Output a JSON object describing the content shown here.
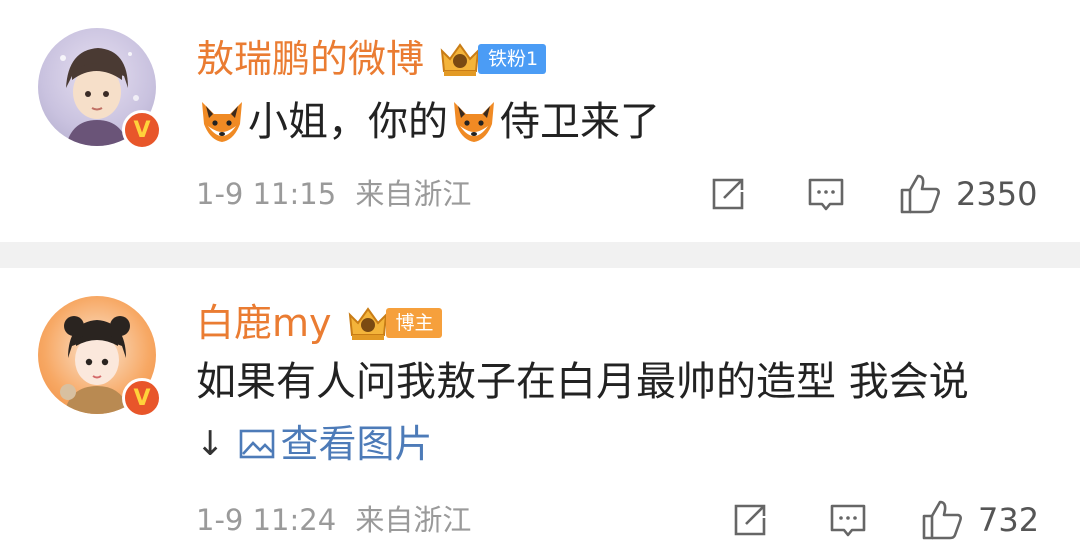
{
  "comments": [
    {
      "username": "敖瑞鹏的微博",
      "badge_text": "铁粉1",
      "badge_color": "#4b9cf5",
      "verified_glyph": "V",
      "text_parts": [
        "小姐，你的",
        "侍卫来了"
      ],
      "emoji": "fox-emoji",
      "time": "1-9 11:15",
      "location": "来自浙江",
      "likes": "2350"
    },
    {
      "username": "白鹿my",
      "badge_text": "博主",
      "badge_color": "#f6a03c",
      "verified_glyph": "V",
      "text": "如果有人问我敖子在白月最帅的造型 我会说",
      "view_image_label": "查看图片",
      "arrow": "↓",
      "time": "1-9 11:24",
      "location": "来自浙江",
      "likes": "732"
    }
  ],
  "colors": {
    "username": "#ea7c32",
    "meta": "#9a9a9a",
    "link": "#4d7bb8",
    "divider": "#f1f1f1"
  },
  "icons": [
    "share-icon",
    "comment-icon",
    "thumbs-up-icon",
    "crown-icon",
    "image-icon",
    "fox-emoji"
  ]
}
